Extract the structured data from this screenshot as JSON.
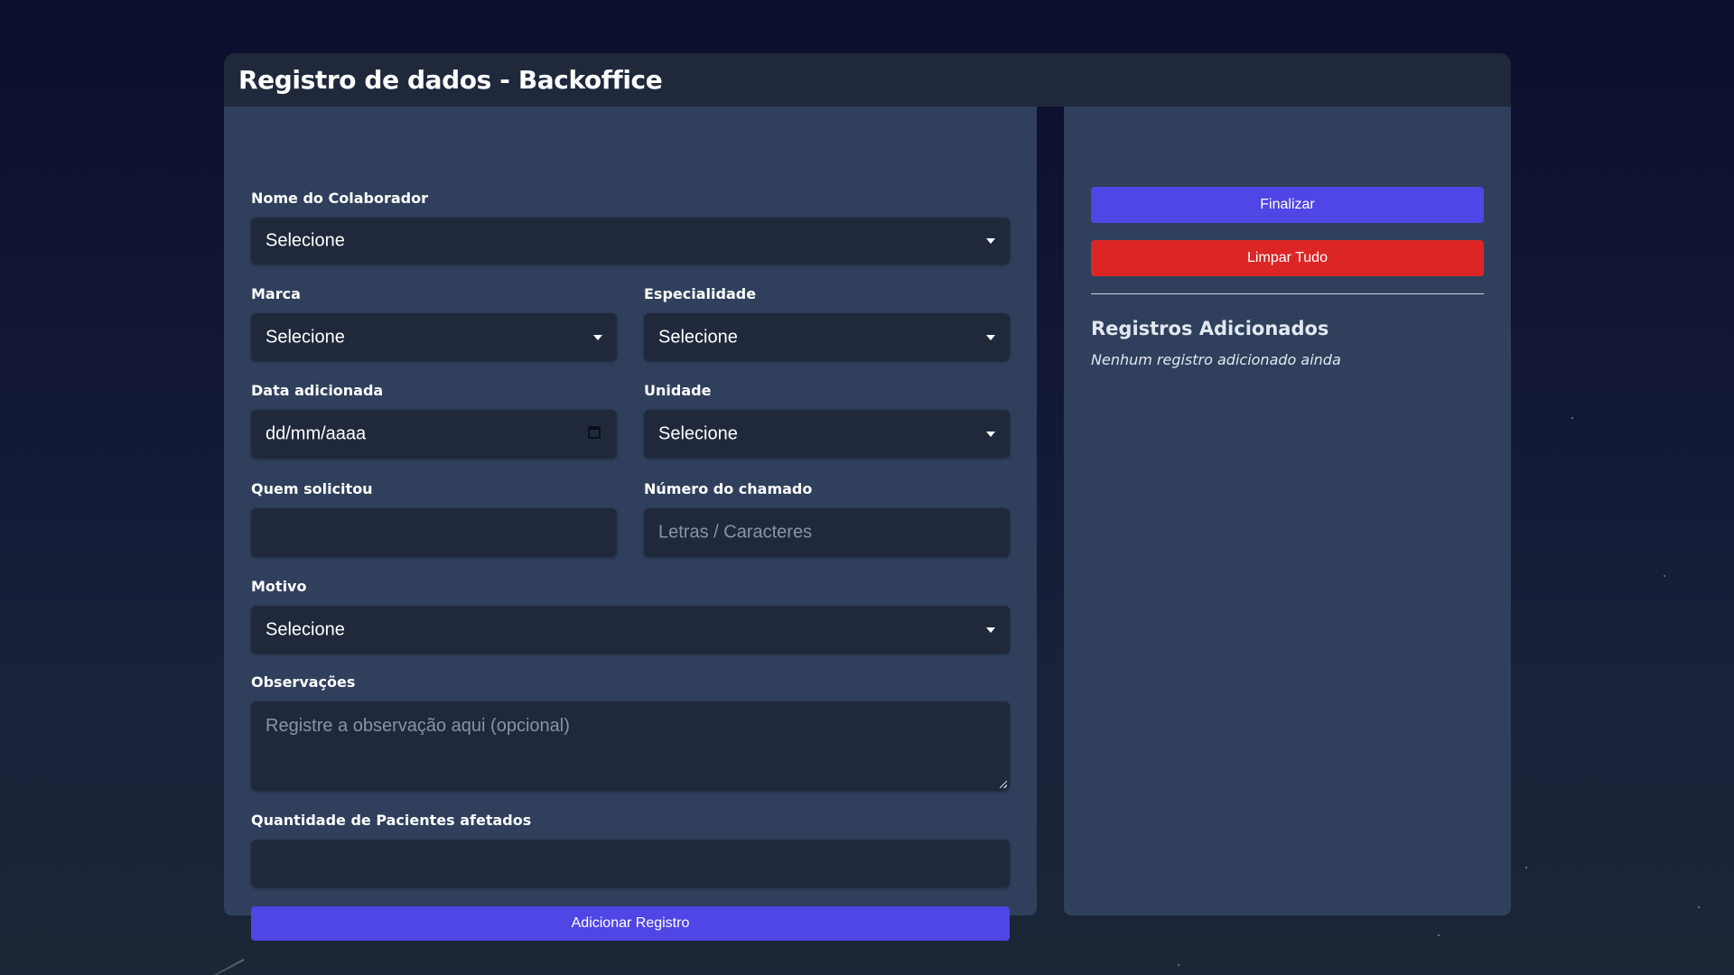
{
  "page": {
    "title": "Registro de dados - Backoffice"
  },
  "form": {
    "colaborador": {
      "label": "Nome do Colaborador",
      "value": "Selecione"
    },
    "marca": {
      "label": "Marca",
      "value": "Selecione"
    },
    "especialidade": {
      "label": "Especialidade",
      "value": "Selecione"
    },
    "data": {
      "label": "Data adicionada",
      "placeholder": "dd/mm/aaaa"
    },
    "unidade": {
      "label": "Unidade",
      "value": "Selecione"
    },
    "solicitante": {
      "label": "Quem solicitou",
      "value": ""
    },
    "chamado": {
      "label": "Número do chamado",
      "placeholder": "Letras / Caracteres"
    },
    "motivo": {
      "label": "Motivo",
      "value": "Selecione"
    },
    "observacoes": {
      "label": "Observações",
      "placeholder": "Registre a observação aqui (opcional)"
    },
    "quantidade": {
      "label": "Quantidade de Pacientes afetados",
      "value": ""
    },
    "add_button": "Adicionar Registro"
  },
  "sidebar": {
    "finalize_button": "Finalizar",
    "clear_button": "Limpar Tudo",
    "records_title": "Registros Adicionados",
    "records_empty": "Nenhum registro adicionado ainda"
  },
  "colors": {
    "background": "#0b0e2c",
    "panel": "#2f3f5c",
    "field": "#1f293b",
    "primary": "#4f46e5",
    "danger": "#dc2626"
  },
  "icons": {
    "select_caret": "chevron-down-icon",
    "date_picker": "calendar-icon",
    "resize": "resize-handle-icon"
  }
}
